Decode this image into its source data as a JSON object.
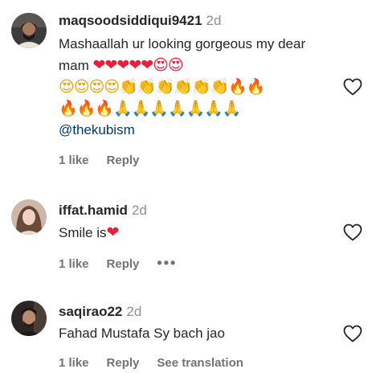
{
  "comments": [
    {
      "username": "maqsoodsiddiqui9421",
      "time": "2d",
      "text": "Mashaallah ur looking gorgeous my dear mam",
      "emoji_line1": "❤❤❤❤❤😍😍",
      "emoji_line2": "😍😍😍😍👏👏👏👏👏👏🔥🔥",
      "emoji_line3": "🔥🔥🔥🙏🙏🙏🙏🙏🙏🙏",
      "mention": "@thekubism",
      "likes": "1 like",
      "reply": "Reply"
    },
    {
      "username": "iffat.hamid",
      "time": "2d",
      "text": "Smile is",
      "emoji": "❤",
      "likes": "1 like",
      "reply": "Reply",
      "more": "•••"
    },
    {
      "username": "saqirao22",
      "time": "2d",
      "text": "Fahad Mustafa Sy bach jao",
      "likes": "1 like",
      "reply": "Reply",
      "translate": "See translation"
    }
  ],
  "icons": {
    "like": "heart-outline-icon",
    "more": "more-options-icon"
  },
  "colors": {
    "username": "#262626",
    "meta": "#737373",
    "mention": "#00376b",
    "heart": "#ed1c3b"
  }
}
